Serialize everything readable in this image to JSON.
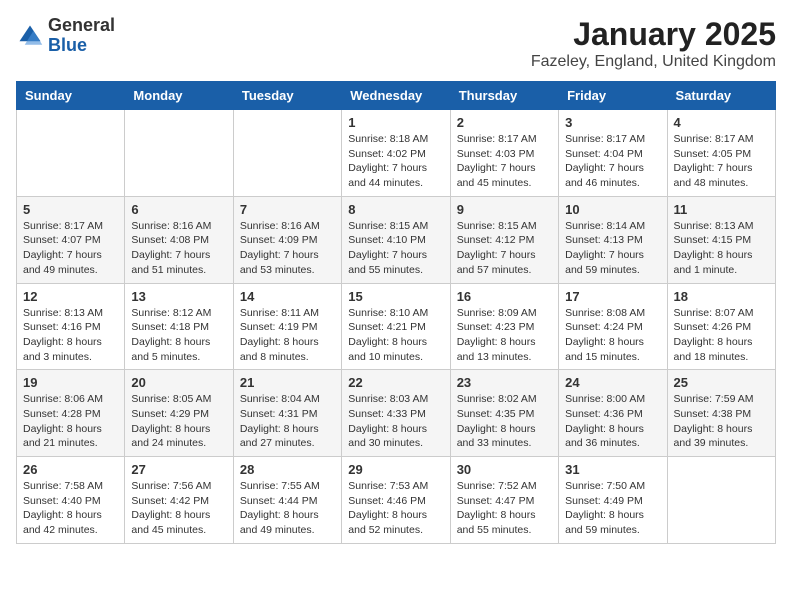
{
  "logo": {
    "general": "General",
    "blue": "Blue"
  },
  "header": {
    "month": "January 2025",
    "location": "Fazeley, England, United Kingdom"
  },
  "weekdays": [
    "Sunday",
    "Monday",
    "Tuesday",
    "Wednesday",
    "Thursday",
    "Friday",
    "Saturday"
  ],
  "weeks": [
    [
      {
        "day": "",
        "info": ""
      },
      {
        "day": "",
        "info": ""
      },
      {
        "day": "",
        "info": ""
      },
      {
        "day": "1",
        "info": "Sunrise: 8:18 AM\nSunset: 4:02 PM\nDaylight: 7 hours\nand 44 minutes."
      },
      {
        "day": "2",
        "info": "Sunrise: 8:17 AM\nSunset: 4:03 PM\nDaylight: 7 hours\nand 45 minutes."
      },
      {
        "day": "3",
        "info": "Sunrise: 8:17 AM\nSunset: 4:04 PM\nDaylight: 7 hours\nand 46 minutes."
      },
      {
        "day": "4",
        "info": "Sunrise: 8:17 AM\nSunset: 4:05 PM\nDaylight: 7 hours\nand 48 minutes."
      }
    ],
    [
      {
        "day": "5",
        "info": "Sunrise: 8:17 AM\nSunset: 4:07 PM\nDaylight: 7 hours\nand 49 minutes."
      },
      {
        "day": "6",
        "info": "Sunrise: 8:16 AM\nSunset: 4:08 PM\nDaylight: 7 hours\nand 51 minutes."
      },
      {
        "day": "7",
        "info": "Sunrise: 8:16 AM\nSunset: 4:09 PM\nDaylight: 7 hours\nand 53 minutes."
      },
      {
        "day": "8",
        "info": "Sunrise: 8:15 AM\nSunset: 4:10 PM\nDaylight: 7 hours\nand 55 minutes."
      },
      {
        "day": "9",
        "info": "Sunrise: 8:15 AM\nSunset: 4:12 PM\nDaylight: 7 hours\nand 57 minutes."
      },
      {
        "day": "10",
        "info": "Sunrise: 8:14 AM\nSunset: 4:13 PM\nDaylight: 7 hours\nand 59 minutes."
      },
      {
        "day": "11",
        "info": "Sunrise: 8:13 AM\nSunset: 4:15 PM\nDaylight: 8 hours\nand 1 minute."
      }
    ],
    [
      {
        "day": "12",
        "info": "Sunrise: 8:13 AM\nSunset: 4:16 PM\nDaylight: 8 hours\nand 3 minutes."
      },
      {
        "day": "13",
        "info": "Sunrise: 8:12 AM\nSunset: 4:18 PM\nDaylight: 8 hours\nand 5 minutes."
      },
      {
        "day": "14",
        "info": "Sunrise: 8:11 AM\nSunset: 4:19 PM\nDaylight: 8 hours\nand 8 minutes."
      },
      {
        "day": "15",
        "info": "Sunrise: 8:10 AM\nSunset: 4:21 PM\nDaylight: 8 hours\nand 10 minutes."
      },
      {
        "day": "16",
        "info": "Sunrise: 8:09 AM\nSunset: 4:23 PM\nDaylight: 8 hours\nand 13 minutes."
      },
      {
        "day": "17",
        "info": "Sunrise: 8:08 AM\nSunset: 4:24 PM\nDaylight: 8 hours\nand 15 minutes."
      },
      {
        "day": "18",
        "info": "Sunrise: 8:07 AM\nSunset: 4:26 PM\nDaylight: 8 hours\nand 18 minutes."
      }
    ],
    [
      {
        "day": "19",
        "info": "Sunrise: 8:06 AM\nSunset: 4:28 PM\nDaylight: 8 hours\nand 21 minutes."
      },
      {
        "day": "20",
        "info": "Sunrise: 8:05 AM\nSunset: 4:29 PM\nDaylight: 8 hours\nand 24 minutes."
      },
      {
        "day": "21",
        "info": "Sunrise: 8:04 AM\nSunset: 4:31 PM\nDaylight: 8 hours\nand 27 minutes."
      },
      {
        "day": "22",
        "info": "Sunrise: 8:03 AM\nSunset: 4:33 PM\nDaylight: 8 hours\nand 30 minutes."
      },
      {
        "day": "23",
        "info": "Sunrise: 8:02 AM\nSunset: 4:35 PM\nDaylight: 8 hours\nand 33 minutes."
      },
      {
        "day": "24",
        "info": "Sunrise: 8:00 AM\nSunset: 4:36 PM\nDaylight: 8 hours\nand 36 minutes."
      },
      {
        "day": "25",
        "info": "Sunrise: 7:59 AM\nSunset: 4:38 PM\nDaylight: 8 hours\nand 39 minutes."
      }
    ],
    [
      {
        "day": "26",
        "info": "Sunrise: 7:58 AM\nSunset: 4:40 PM\nDaylight: 8 hours\nand 42 minutes."
      },
      {
        "day": "27",
        "info": "Sunrise: 7:56 AM\nSunset: 4:42 PM\nDaylight: 8 hours\nand 45 minutes."
      },
      {
        "day": "28",
        "info": "Sunrise: 7:55 AM\nSunset: 4:44 PM\nDaylight: 8 hours\nand 49 minutes."
      },
      {
        "day": "29",
        "info": "Sunrise: 7:53 AM\nSunset: 4:46 PM\nDaylight: 8 hours\nand 52 minutes."
      },
      {
        "day": "30",
        "info": "Sunrise: 7:52 AM\nSunset: 4:47 PM\nDaylight: 8 hours\nand 55 minutes."
      },
      {
        "day": "31",
        "info": "Sunrise: 7:50 AM\nSunset: 4:49 PM\nDaylight: 8 hours\nand 59 minutes."
      },
      {
        "day": "",
        "info": ""
      }
    ]
  ]
}
